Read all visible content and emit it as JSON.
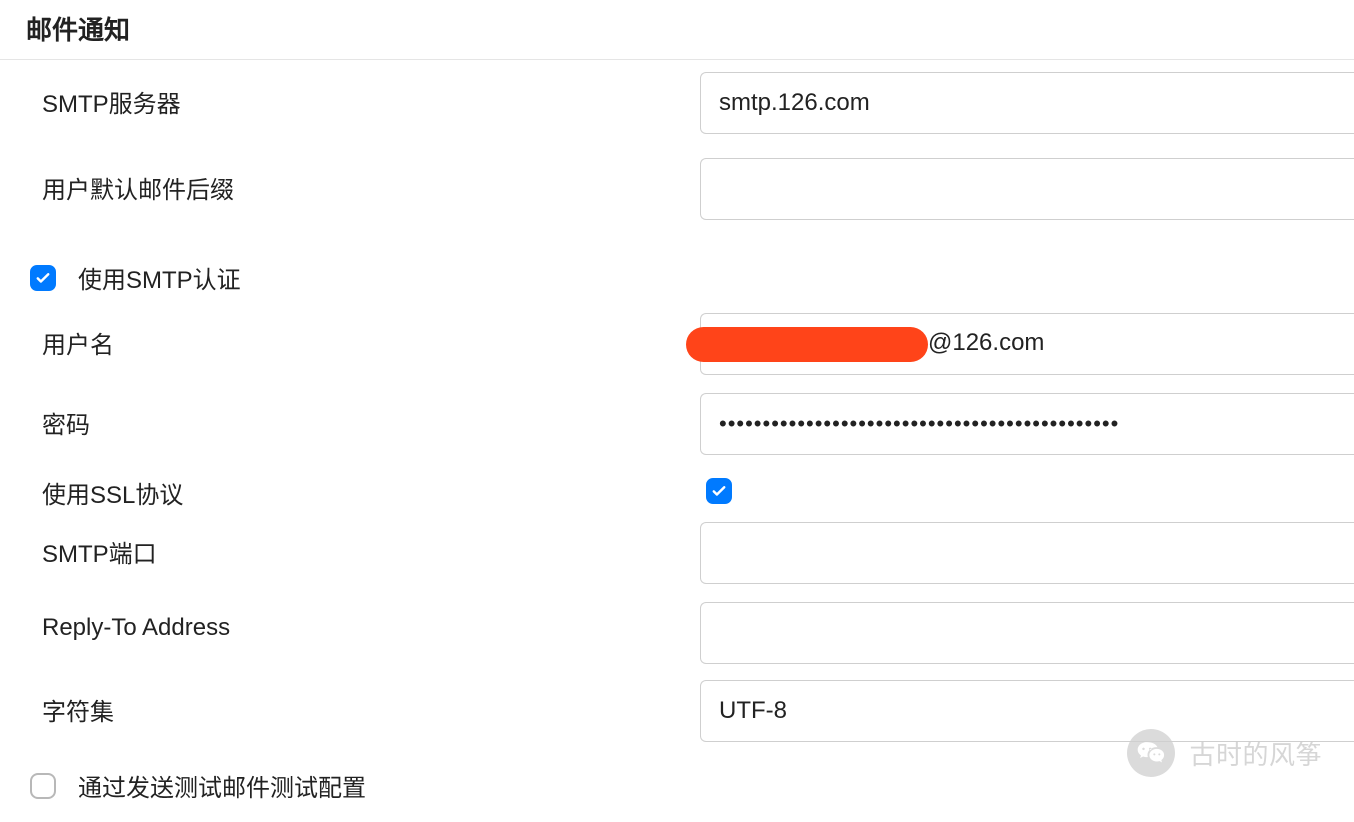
{
  "section": {
    "title": "邮件通知"
  },
  "fields": {
    "smtp_server": {
      "label": "SMTP服务器",
      "value": "smtp.126.com"
    },
    "default_suffix": {
      "label": "用户默认邮件后缀",
      "value": ""
    },
    "use_smtp_auth": {
      "label": "使用SMTP认证",
      "checked": true
    },
    "username": {
      "label": "用户名",
      "value": "",
      "visible_suffix": "@126.com"
    },
    "password": {
      "label": "密码",
      "value": "••••••••••••••••••••••••••••••••••••••••••••••"
    },
    "use_ssl": {
      "label": "使用SSL协议",
      "checked": true
    },
    "smtp_port": {
      "label": "SMTP端口",
      "value": ""
    },
    "reply_to": {
      "label": "Reply-To Address",
      "value": ""
    },
    "charset": {
      "label": "字符集",
      "value": "UTF-8"
    },
    "test_email": {
      "label": "通过发送测试邮件测试配置",
      "checked": false
    }
  },
  "watermark": {
    "text": "古时的风筝",
    "icon": "wechat-icon"
  }
}
